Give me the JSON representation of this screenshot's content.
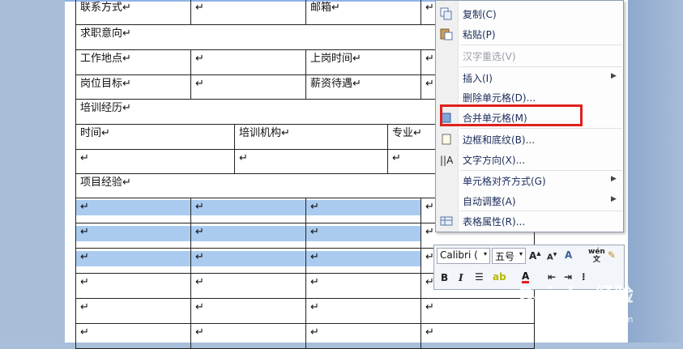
{
  "table": {
    "contact": "联系方式",
    "email": "邮箱",
    "intention": "求职意向",
    "location": "工作地点",
    "start_time": "上岗时间",
    "target": "岗位目标",
    "salary": "薪资待遇",
    "training": "培训经历",
    "time": "时间",
    "institution": "培训机构",
    "major": "专业",
    "project": "项目经验",
    "mark": "↵"
  },
  "context_menu": {
    "items": [
      {
        "label": "复制(C)",
        "icon": "copy-icon",
        "enabled": true
      },
      {
        "label": "粘贴(P)",
        "icon": "paste-icon",
        "enabled": true
      },
      {
        "label": "汉字重选(V)",
        "icon": "",
        "enabled": false
      },
      {
        "label": "插入(I)",
        "icon": "",
        "enabled": true,
        "submenu": true
      },
      {
        "label": "删除单元格(D)...",
        "icon": "",
        "enabled": true
      },
      {
        "label": "合并单元格(M)",
        "icon": "merge-cells-icon",
        "enabled": true
      },
      {
        "label": "边框和底纹(B)...",
        "icon": "borders-icon",
        "enabled": true
      },
      {
        "label": "文字方向(X)...",
        "icon": "text-direction-icon",
        "enabled": true
      },
      {
        "label": "单元格对齐方式(G)",
        "icon": "",
        "enabled": true,
        "submenu": true
      },
      {
        "label": "自动调整(A)",
        "icon": "",
        "enabled": true,
        "submenu": true
      },
      {
        "label": "表格属性(R)...",
        "icon": "table-properties-icon",
        "enabled": true
      }
    ],
    "highlight_color": "#e0201c"
  },
  "mini_toolbar": {
    "font": "Calibri ( ",
    "size": "五号",
    "bold": "B",
    "italic": "I",
    "wen": "wén\n文"
  },
  "watermark": {
    "brand": "Bai du 经验",
    "url": "jingyan.baidu.com"
  }
}
